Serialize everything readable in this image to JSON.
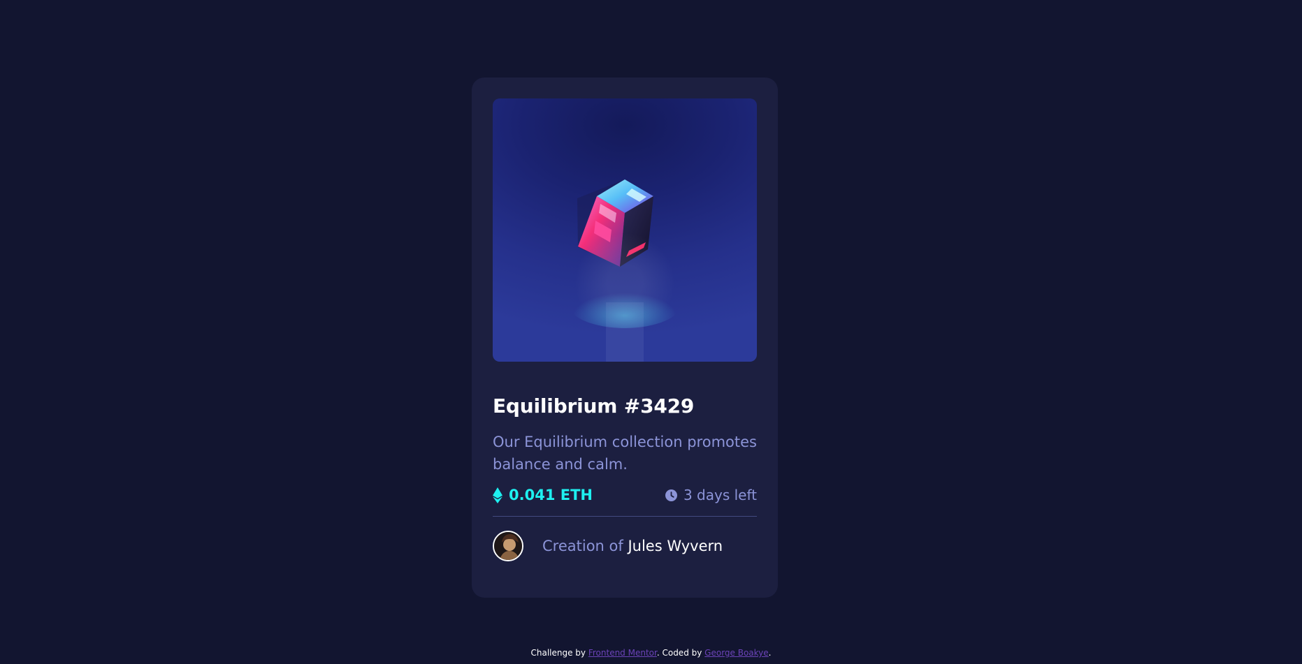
{
  "nft": {
    "title": "Equilibrium #3429",
    "description": "Our Equilibrium collection promotes balance and calm.",
    "price": "0.041 ETH",
    "time_left": "3 days left",
    "creator_prefix": "Creation of",
    "creator_name": "Jules Wyvern"
  },
  "footer": {
    "challenge_prefix": "Challenge by",
    "challenge_link": "Frontend Mentor",
    "coded_prefix": ". Coded by",
    "coded_link": "George Boakye",
    "suffix": "."
  },
  "icons": {
    "eth": "ethereum-icon",
    "clock": "clock-icon"
  },
  "colors": {
    "page_bg": "#121530",
    "card_bg": "#1c1f40",
    "accent": "#1ef0f0",
    "muted": "#8c94d8",
    "white": "#ffffff",
    "link": "#6b43b8"
  }
}
